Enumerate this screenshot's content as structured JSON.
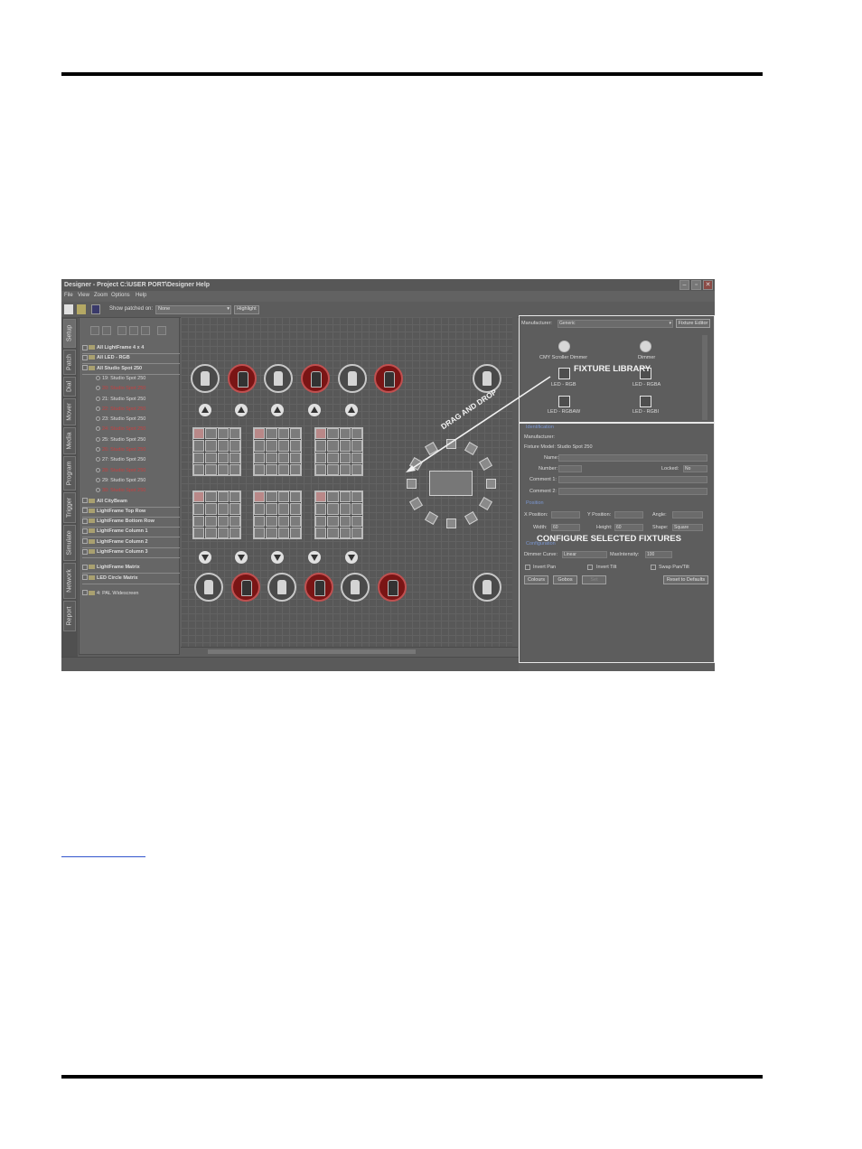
{
  "window": {
    "title": "Designer - Project C:\\USER PORT\\Designer Help",
    "menu": [
      "File",
      "View",
      "Zoom",
      "Options",
      "Help"
    ]
  },
  "toolbar": {
    "show_patched_label": "Show patched on:",
    "show_patched_value": "None",
    "highlight_label": "Highlight"
  },
  "tabs": [
    "Setup",
    "Patch",
    "Dial",
    "Mover",
    "Media",
    "Program",
    "Trigger",
    "Simulate",
    "Network",
    "Report"
  ],
  "tree": [
    {
      "label": "All LightFrame 4 x 4",
      "type": "group"
    },
    {
      "label": "All LED - RGB",
      "type": "group"
    },
    {
      "label": "All Studio Spot 250",
      "type": "group"
    },
    {
      "label": "19: Studio Spot 250",
      "type": "item"
    },
    {
      "label": "20: Studio Spot 250",
      "type": "item",
      "red": true
    },
    {
      "label": "21: Studio Spot 250",
      "type": "item"
    },
    {
      "label": "22: Studio Spot 250",
      "type": "item",
      "red": true
    },
    {
      "label": "23: Studio Spot 250",
      "type": "item"
    },
    {
      "label": "24: Studio Spot 250",
      "type": "item",
      "red": true
    },
    {
      "label": "25: Studio Spot 250",
      "type": "item"
    },
    {
      "label": "26: Studio Spot 250",
      "type": "item",
      "red": true
    },
    {
      "label": "27: Studio Spot 250",
      "type": "item"
    },
    {
      "label": "28: Studio Spot 250",
      "type": "item",
      "red": true
    },
    {
      "label": "29: Studio Spot 250",
      "type": "item"
    },
    {
      "label": "30: Studio Spot 250",
      "type": "item",
      "red": true
    },
    {
      "label": "All CityBeam",
      "type": "group"
    },
    {
      "label": "LightFrame Top Row",
      "type": "group"
    },
    {
      "label": "LightFrame Bottom Row",
      "type": "group"
    },
    {
      "label": "LightFrame Column 1",
      "type": "group"
    },
    {
      "label": "LightFrame Column 2",
      "type": "group"
    },
    {
      "label": "LightFrame Column 3",
      "type": "group"
    },
    {
      "label": "LightFrame Matrix",
      "type": "group"
    },
    {
      "label": "LED Circle Matrix",
      "type": "group"
    },
    {
      "label": "4: PAL Widescreen",
      "type": "item"
    }
  ],
  "library": {
    "manufacturer_label": "Manufacturer:",
    "manufacturer_value": "Generic",
    "fixture_editor": "Fixture Editor",
    "items": [
      "CMY Scroller Dimmer",
      "Dimmer",
      "LED - RGB",
      "LED - RGBA",
      "LED - RGBAW",
      "LED - RGBI"
    ]
  },
  "identification": {
    "heading": "Identification",
    "manufacturer": "Manufacturer:",
    "fixture_model": "Fixture Model: Studio Spot 250",
    "name": "Name:",
    "number": "Number:",
    "locked_label": "Locked:",
    "locked_value": "No",
    "comment1": "Comment 1:",
    "comment2": "Comment 2:"
  },
  "position": {
    "heading": "Position",
    "x": "X Position:",
    "y": "Y Position:",
    "angle": "Angle:",
    "width_label": "Width:",
    "width_value": "60",
    "height_label": "Height:",
    "height_value": "60",
    "shape_label": "Shape:",
    "shape_value": "Square"
  },
  "config": {
    "heading": "Configuration",
    "dimmer_curve_label": "Dimmer Curve:",
    "dimmer_curve_value": "Linear",
    "max_intensity_label": "MaxIntensity:",
    "max_intensity_value": "100",
    "invert_pan": "Invert Pan",
    "invert_tilt": "Invert Tilt",
    "swap_pan_tilt": "Swap Pan/Tilt",
    "colours": "Colours",
    "gobos": "Gobos",
    "set": "Set",
    "reset": "Reset to Defaults"
  },
  "overlays": {
    "fixture_library": "FIXTURE LIBRARY",
    "drag_and_drop": "DRAG AND DROP",
    "configure": "CONFIGURE SELECTED FIXTURES"
  },
  "colors": {
    "red_fixture": "#7a1515",
    "overlay_text": "#f4f4f4",
    "section_heading": "#7a96d0"
  }
}
